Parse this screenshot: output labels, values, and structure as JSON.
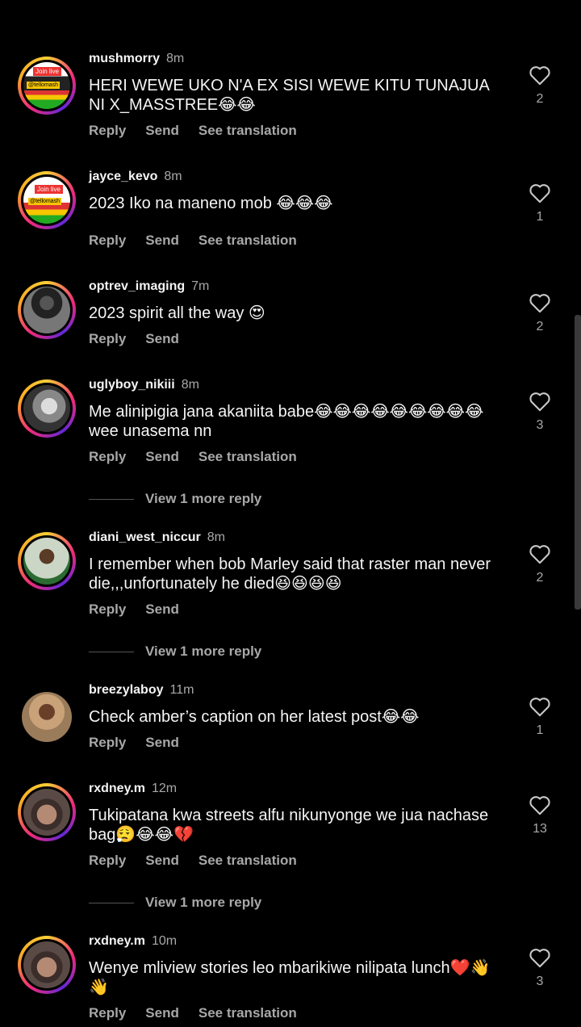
{
  "comments": [
    {
      "user": "mushmorry",
      "time": "8m",
      "text": "HERI WEWE UKO N'A EX SISI WEWE KITU TUNAJUA NI X_MASSTREE😂😂",
      "likes": "2",
      "actions": [
        "Reply",
        "Send",
        "See translation"
      ],
      "avatar_badge": "Join live",
      "avatar_handle": "@tellomash"
    },
    {
      "user": "jayce_kevo",
      "time": "8m",
      "text": "2023 Iko na maneno mob 😂😂😂",
      "likes": "1",
      "actions": [
        "Reply",
        "Send",
        "See translation"
      ],
      "avatar_badge": "Join live",
      "avatar_handle": "@tellomash"
    },
    {
      "user": "optrev_imaging",
      "time": "7m",
      "text": "2023 spirit all the way 😍",
      "likes": "2",
      "actions": [
        "Reply",
        "Send"
      ]
    },
    {
      "user": "uglyboy_nikiii",
      "time": "8m",
      "text": "Me alinipigia jana akaniita babe😂😂😂😂😂😂😂😂😂 wee unasema nn",
      "likes": "3",
      "actions": [
        "Reply",
        "Send",
        "See translation"
      ],
      "more": "View 1 more reply"
    },
    {
      "user": "diani_west_niccur",
      "time": "8m",
      "text": "I remember when bob Marley said that raster man never die,,,unfortunately he died😆😆😆😆",
      "likes": "2",
      "actions": [
        "Reply",
        "Send"
      ],
      "more": "View 1 more reply"
    },
    {
      "user": "breezylaboy",
      "time": "11m",
      "text": "Check amber’s caption on her latest post😂😂",
      "likes": "1",
      "actions": [
        "Reply",
        "Send"
      ]
    },
    {
      "user": "rxdney.m",
      "time": "12m",
      "text": "Tukipatana kwa streets alfu nikunyonge we jua nachase bag😮‍💨😂😂💔",
      "likes": "13",
      "actions": [
        "Reply",
        "Send",
        "See translation"
      ],
      "more": "View 1 more reply"
    },
    {
      "user": "rxdney.m",
      "time": "10m",
      "text": "Wenye mliview stories leo mbarikiwe nilipata lunch❤️👋 👋",
      "likes": "3",
      "actions": [
        "Reply",
        "Send",
        "See translation"
      ]
    }
  ]
}
